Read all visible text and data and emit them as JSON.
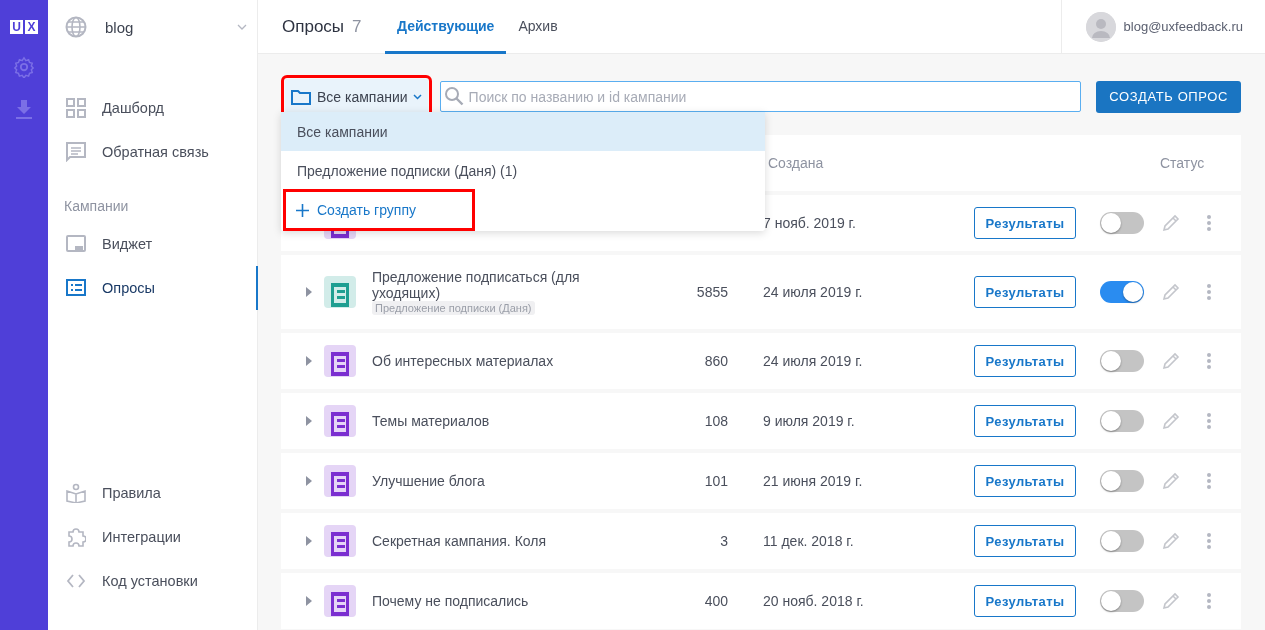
{
  "rail": {
    "logo_letters": [
      "U",
      "X"
    ]
  },
  "project": {
    "name": "blog"
  },
  "sidebar": {
    "items": [
      {
        "kind": "dashboard",
        "label": "Дашборд",
        "selected": false
      },
      {
        "kind": "feedback",
        "label": "Обратная связь",
        "selected": false
      }
    ],
    "section_label": "Кампании",
    "campaign_items": [
      {
        "kind": "widget",
        "label": "Виджет",
        "selected": false
      },
      {
        "kind": "surveys",
        "label": "Опросы",
        "selected": true
      }
    ],
    "bottom_items": [
      {
        "kind": "rules",
        "label": "Правила",
        "selected": false
      },
      {
        "kind": "integrations",
        "label": "Интеграции",
        "selected": false
      },
      {
        "kind": "code",
        "label": "Код установки",
        "selected": false
      }
    ]
  },
  "header": {
    "title": "Опросы",
    "count": "7",
    "tabs": [
      {
        "label": "Действующие",
        "selected": true
      },
      {
        "label": "Архив",
        "selected": false
      }
    ],
    "user_email": "blog@uxfeedback.ru"
  },
  "toolbar": {
    "filter": {
      "label": "Все кампании",
      "highlighted": true
    },
    "search": {
      "placeholder": "Поиск по названию и id кампании"
    },
    "create_button": "СОЗДАТЬ ОПРОС"
  },
  "dropdown": {
    "items": [
      {
        "label": "Все кампании",
        "selected": true
      },
      {
        "label": "Предложение подписки (Даня) (1)",
        "selected": false
      }
    ],
    "create_group": {
      "label": "Создать группу",
      "highlighted": true
    }
  },
  "table": {
    "column_created": "Создана",
    "column_status": "Статус",
    "rows": [
      {
        "date": "7 нояб. 2019 г.",
        "results": "Результаты",
        "on": false,
        "color": "#7b2fd0"
      },
      {
        "name": "Предложение подписаться (для уходящих)",
        "tag": "Предложение подписки (Даня)",
        "count": "5855",
        "date": "24 июля 2019 г.",
        "results": "Результаты",
        "on": true,
        "color": "#1e9e91"
      },
      {
        "name": "Об интересных материалах",
        "count": "860",
        "date": "24 июля 2019 г.",
        "results": "Результаты",
        "on": false,
        "color": "#7b2fd0"
      },
      {
        "name": "Темы материалов",
        "count": "108",
        "date": "9 июля 2019 г.",
        "results": "Результаты",
        "on": false,
        "color": "#7b2fd0"
      },
      {
        "name": "Улучшение блога",
        "count": "101",
        "date": "21 июня 2019 г.",
        "results": "Результаты",
        "on": false,
        "color": "#7b2fd0"
      },
      {
        "name": "Секретная кампания. Коля",
        "count": "3",
        "date": "11 дек. 2018 г.",
        "results": "Результаты",
        "on": false,
        "color": "#7b2fd0"
      },
      {
        "name": "Почему не подписались",
        "count": "400",
        "date": "20 нояб. 2018 г.",
        "results": "Результаты",
        "on": false,
        "color": "#7b2fd0"
      }
    ]
  }
}
